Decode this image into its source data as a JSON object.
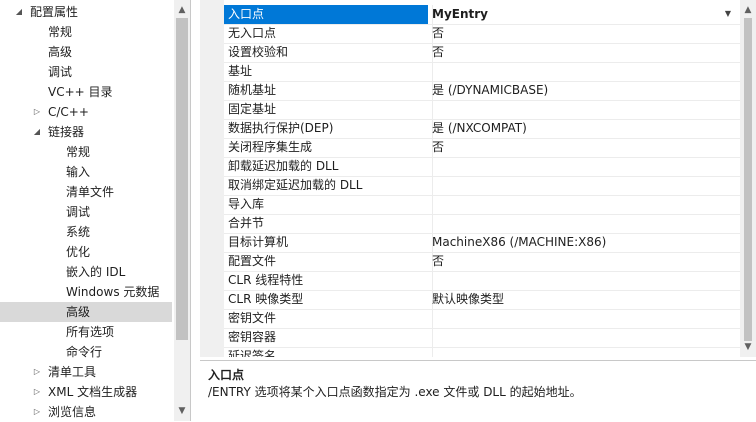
{
  "tree": {
    "items": [
      {
        "label": "配置属性",
        "arrow": "◢",
        "indent": 0
      },
      {
        "label": "常规",
        "arrow": "",
        "indent": 1
      },
      {
        "label": "高级",
        "arrow": "",
        "indent": 1
      },
      {
        "label": "调试",
        "arrow": "",
        "indent": 1
      },
      {
        "label": "VC++ 目录",
        "arrow": "",
        "indent": 1
      },
      {
        "label": "C/C++",
        "arrow": "▷",
        "indent": 1
      },
      {
        "label": "链接器",
        "arrow": "◢",
        "indent": 1
      },
      {
        "label": "常规",
        "arrow": "",
        "indent": 2
      },
      {
        "label": "输入",
        "arrow": "",
        "indent": 2
      },
      {
        "label": "清单文件",
        "arrow": "",
        "indent": 2
      },
      {
        "label": "调试",
        "arrow": "",
        "indent": 2
      },
      {
        "label": "系统",
        "arrow": "",
        "indent": 2
      },
      {
        "label": "优化",
        "arrow": "",
        "indent": 2
      },
      {
        "label": "嵌入的 IDL",
        "arrow": "",
        "indent": 2
      },
      {
        "label": "Windows 元数据",
        "arrow": "",
        "indent": 2
      },
      {
        "label": "高级",
        "arrow": "",
        "indent": 2,
        "selected": true
      },
      {
        "label": "所有选项",
        "arrow": "",
        "indent": 2
      },
      {
        "label": "命令行",
        "arrow": "",
        "indent": 2
      },
      {
        "label": "清单工具",
        "arrow": "▷",
        "indent": 1
      },
      {
        "label": "XML 文档生成器",
        "arrow": "▷",
        "indent": 1
      },
      {
        "label": "浏览信息",
        "arrow": "▷",
        "indent": 1
      }
    ]
  },
  "grid": {
    "rows": [
      {
        "name": "入口点",
        "value": "MyEntry",
        "selected": true
      },
      {
        "name": "无入口点",
        "value": "否"
      },
      {
        "name": "设置校验和",
        "value": "否"
      },
      {
        "name": "基址",
        "value": ""
      },
      {
        "name": "随机基址",
        "value": "是 (/DYNAMICBASE)"
      },
      {
        "name": "固定基址",
        "value": ""
      },
      {
        "name": "数据执行保护(DEP)",
        "value": "是 (/NXCOMPAT)"
      },
      {
        "name": "关闭程序集生成",
        "value": "否"
      },
      {
        "name": "卸载延迟加载的 DLL",
        "value": ""
      },
      {
        "name": "取消绑定延迟加载的 DLL",
        "value": ""
      },
      {
        "name": "导入库",
        "value": ""
      },
      {
        "name": "合并节",
        "value": ""
      },
      {
        "name": "目标计算机",
        "value": "MachineX86 (/MACHINE:X86)"
      },
      {
        "name": "配置文件",
        "value": "否"
      },
      {
        "name": "CLR 线程特性",
        "value": ""
      },
      {
        "name": "CLR 映像类型",
        "value": "默认映像类型"
      },
      {
        "name": "密钥文件",
        "value": ""
      },
      {
        "name": "密钥容器",
        "value": ""
      },
      {
        "name": "延迟签名",
        "value": ""
      }
    ]
  },
  "description": {
    "title": "入口点",
    "text": "/ENTRY 选项将某个入口点函数指定为 .exe 文件或 DLL 的起始地址。"
  },
  "colors": {
    "selection_blue": "#0078d7",
    "tree_selection": "#d9d9d9",
    "scroll_track": "#f0f0f0",
    "scroll_thumb": "#c2c2c2"
  },
  "icons": {
    "scroll_up": "▲",
    "scroll_down": "▼",
    "dropdown": "▼"
  }
}
